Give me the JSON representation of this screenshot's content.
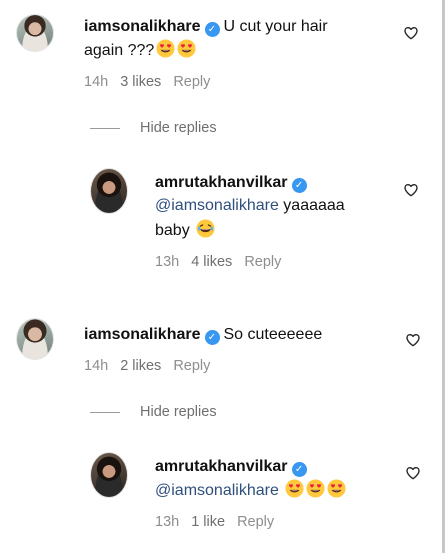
{
  "comments": [
    {
      "username": "iamsonalikhare",
      "text_line1": "U cut your hair",
      "text_line2": "again ???",
      "emojis_line2": [
        "heart-eyes-emoji",
        "heart-eyes-emoji"
      ],
      "time": "14h",
      "likes": "3 likes",
      "reply": "Reply",
      "hide_replies": "Hide replies",
      "reply_item": {
        "username": "amrutakhanvilkar",
        "mention": "@iamsonalikhare",
        "text_line1": " yaaaaaa",
        "text_line2": "baby",
        "emojis_line2": [
          "laughing-emoji"
        ],
        "time": "13h",
        "likes": "4 likes",
        "reply": "Reply"
      }
    },
    {
      "username": "iamsonalikhare",
      "text_line1": "So cuteeeeee",
      "time": "14h",
      "likes": "2 likes",
      "reply": "Reply",
      "hide_replies": "Hide replies",
      "reply_item": {
        "username": "amrutakhanvilkar",
        "mention": "@iamsonalikhare",
        "emojis_line2": [
          "heart-eyes-emoji",
          "heart-eyes-emoji",
          "heart-eyes-emoji"
        ],
        "time": "13h",
        "likes": "1 like",
        "reply": "Reply"
      }
    }
  ],
  "icons": {
    "verified": "verified-badge-icon",
    "like": "heart-outline-icon"
  },
  "colors": {
    "verified": "#3897f0",
    "mention": "#2f4f7d",
    "muted": "#8e8e8e"
  }
}
